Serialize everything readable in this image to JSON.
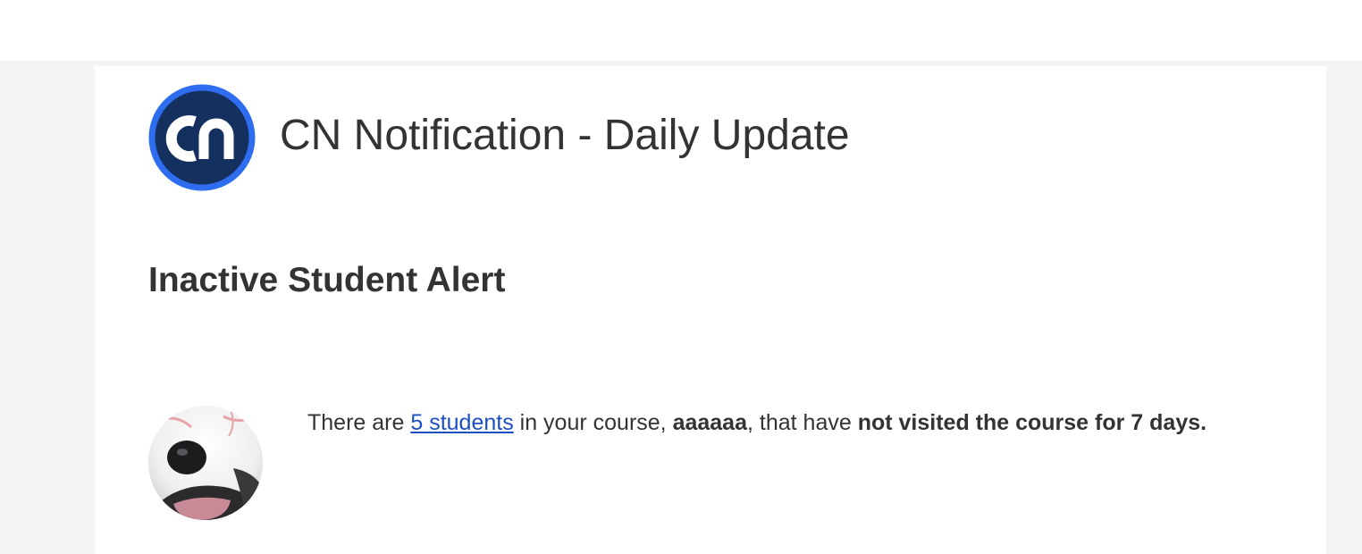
{
  "colors": {
    "page_background": "#f5f5f5",
    "card_background": "#ffffff",
    "text": "#333333",
    "link": "#1d4fc4",
    "logo_ring": "#2e6df0",
    "logo_fill": "#13305f"
  },
  "header": {
    "logo_text": "cn",
    "title": "CN Notification - Daily Update"
  },
  "alert": {
    "heading": "Inactive Student Alert",
    "avatar_icon": "dog-avatar",
    "message": {
      "prefix": "There are ",
      "student_link": "5 students",
      "middle": " in your course, ",
      "course_name": "aaaaaa",
      "suffix": ", that have ",
      "emphasis": "not visited the course for 7 days."
    }
  }
}
